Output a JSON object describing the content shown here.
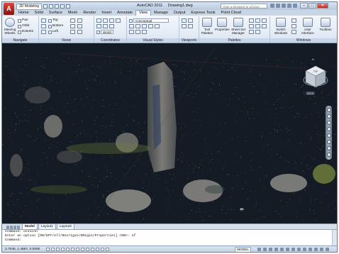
{
  "app": {
    "logo_letter": "A",
    "workspace": "3D Modeling",
    "title": "AutoCAD 2011",
    "document": "Drawing1.dwg",
    "search_placeholder": "Type a keyword or phrase",
    "window_controls": {
      "minimize": "–",
      "restore": "□",
      "close": "✕"
    }
  },
  "ribbon": {
    "tabs": [
      "Home",
      "Solid",
      "Surface",
      "Mesh",
      "Render",
      "Insert",
      "Annotate",
      "View",
      "Manage",
      "Output",
      "Express Tools",
      "Point Cloud"
    ],
    "active_tab": "View",
    "panels": {
      "navigate": {
        "title": "Navigate",
        "steering_wheels": "Steering Wheels",
        "pan": "Pan",
        "orbit": "Orbit",
        "extents": "Extents"
      },
      "views": {
        "title": "Views",
        "items": [
          "Top",
          "Bottom",
          "Left"
        ]
      },
      "coordinates": {
        "title": "Coordinates",
        "world": "World"
      },
      "visual_styles": {
        "title": "Visual Styles",
        "style": "Conceptual"
      },
      "viewports": {
        "title": "Viewports"
      },
      "palettes": {
        "title": "Palettes",
        "tool_palettes": "Tool Palettes",
        "properties": "Properties",
        "sheet_set_manager": "Sheet Set Manager"
      },
      "windows": {
        "title": "Windows",
        "switch_windows": "Switch Windows",
        "user_interface": "User Interface",
        "toolbars": "Toolbars"
      }
    }
  },
  "viewport": {
    "background": "#141b25",
    "viewcube_face": "TOP",
    "compass_n": "N",
    "wcs_label": "WCS",
    "point_colors": [
      "#8c8a84",
      "#a5a39c",
      "#6f7a3e",
      "#9fae4a",
      "#5a5a58"
    ]
  },
  "layout_tabs": [
    "Model",
    "Layout1",
    "Layout2"
  ],
  "active_layout": "Model",
  "command_line": [
    "Command: ucsicon",
    "Enter an option [ON/OFF/All/Noorigin/ORigin/Properties] <ON>: of",
    "Command:"
  ],
  "status": {
    "coords": "3.7045, 1.4657, 0.0000",
    "model": "MODEL"
  }
}
